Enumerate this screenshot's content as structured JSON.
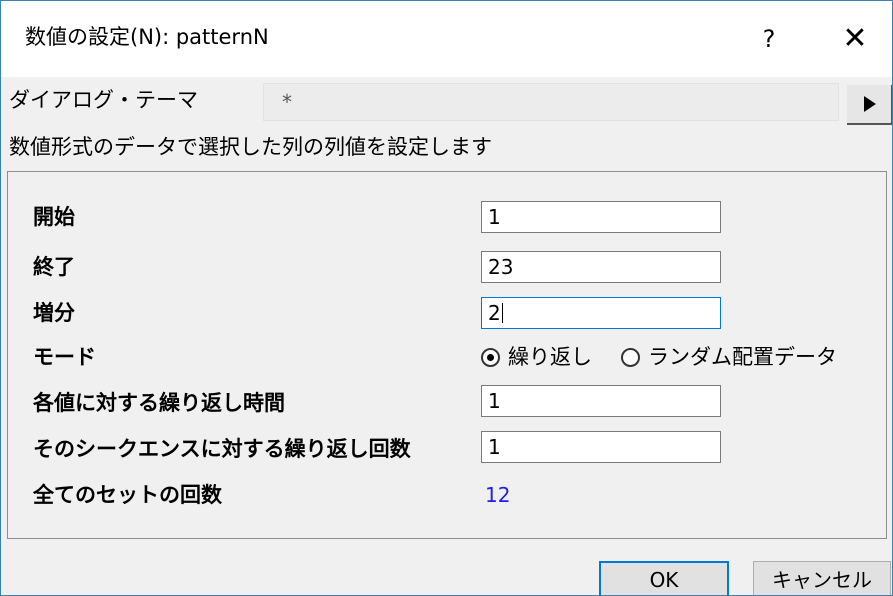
{
  "window": {
    "title": "数値の設定(N): patternN",
    "help_label": "?",
    "close_label": "✕"
  },
  "theme": {
    "label": "ダイアログ・テーマ",
    "value": "*",
    "arrow_icon": "play-right-icon"
  },
  "description": "数値形式のデータで選択した列の列値を設定します",
  "fields": {
    "start": {
      "label": "開始",
      "value": "1"
    },
    "end": {
      "label": "終了",
      "value": "23"
    },
    "increment": {
      "label": "増分",
      "value": "2"
    },
    "mode": {
      "label": "モード",
      "options": [
        "繰り返し",
        "ランダム配置データ"
      ],
      "selected": "繰り返し"
    },
    "repeat_each": {
      "label": "各値に対する繰り返し時間",
      "value": "1"
    },
    "repeat_sequence": {
      "label": "そのシークエンスに対する繰り返し回数",
      "value": "1"
    },
    "total_sets": {
      "label": "全てのセットの回数",
      "value": "12"
    }
  },
  "buttons": {
    "ok": "OK",
    "cancel": "キャンセル"
  },
  "colors": {
    "accent": "#0078d7",
    "value_text": "#2020e8",
    "window_border": "#3c7fb1"
  }
}
